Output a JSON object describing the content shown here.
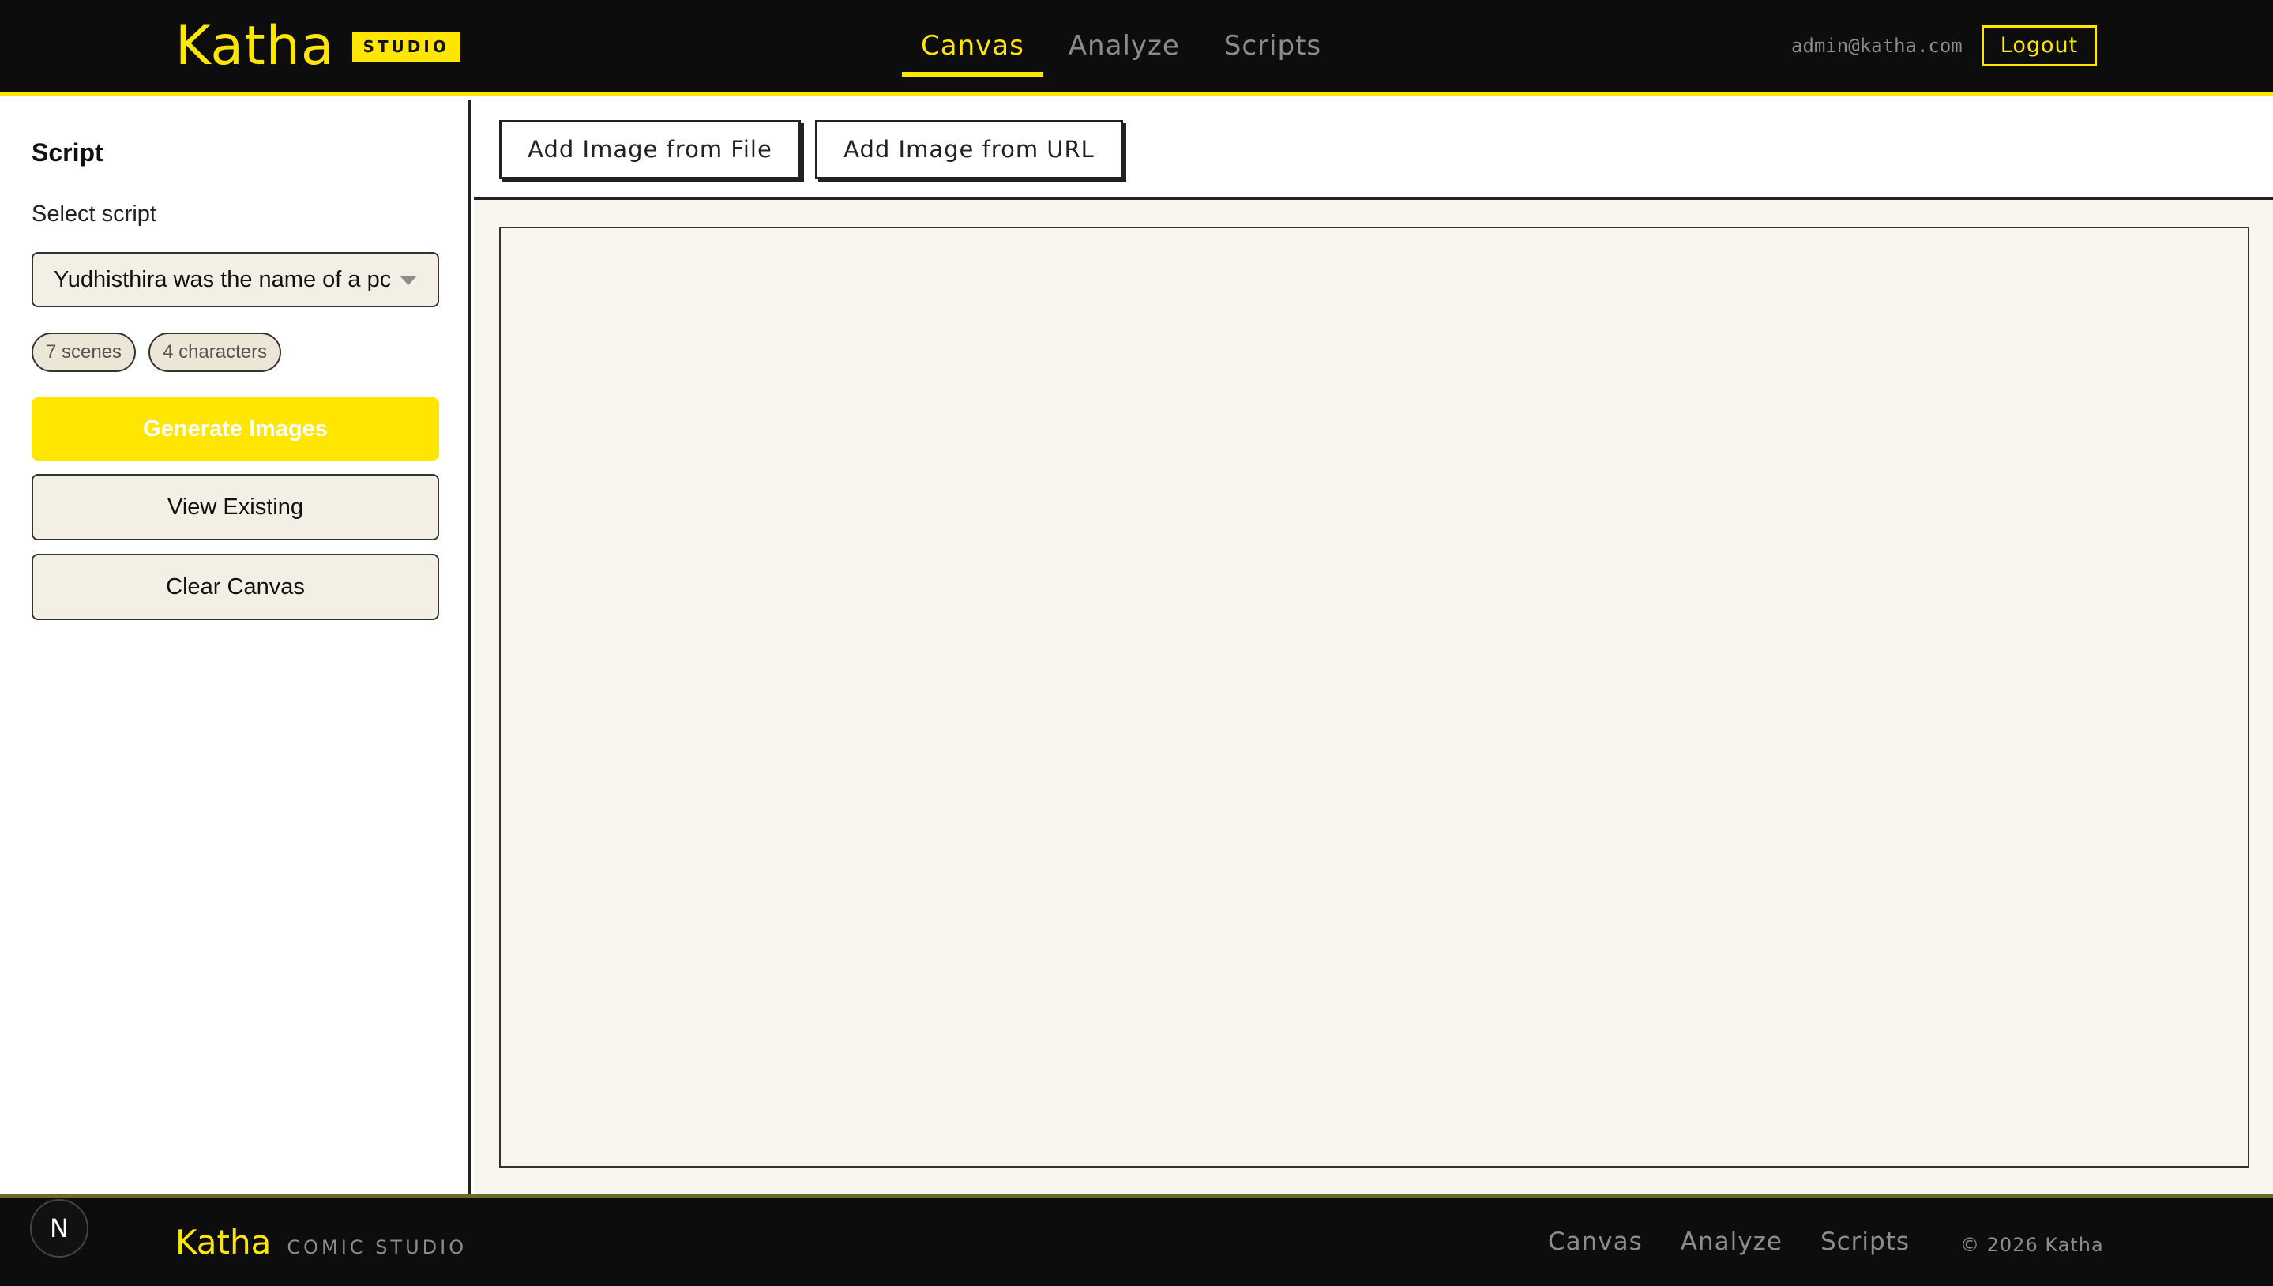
{
  "header": {
    "logo": "Katha",
    "badge": "STUDIO",
    "nav": [
      {
        "label": "Canvas",
        "active": true
      },
      {
        "label": "Analyze",
        "active": false
      },
      {
        "label": "Scripts",
        "active": false
      }
    ],
    "user_email": "admin@katha.com",
    "logout_label": "Logout"
  },
  "sidebar": {
    "title": "Script",
    "select_label": "Select script",
    "selected_script": "Yudhisthira was the name of a pc",
    "pills": [
      "7 scenes",
      "4 characters"
    ],
    "generate_label": "Generate Images",
    "view_label": "View Existing",
    "clear_label": "Clear Canvas"
  },
  "toolbar": {
    "add_file_label": "Add Image from File",
    "add_url_label": "Add Image from URL"
  },
  "footer": {
    "logo": "Katha",
    "sub": "COMIC STUDIO",
    "nav": [
      "Canvas",
      "Analyze",
      "Scripts"
    ],
    "copyright": "© 2026 Katha"
  },
  "dev_badge": "N",
  "colors": {
    "accent": "#ffe600",
    "header_bg": "#0d0d0d",
    "canvas_bg": "#f9f6ef",
    "button_bg": "#f3efe4"
  }
}
